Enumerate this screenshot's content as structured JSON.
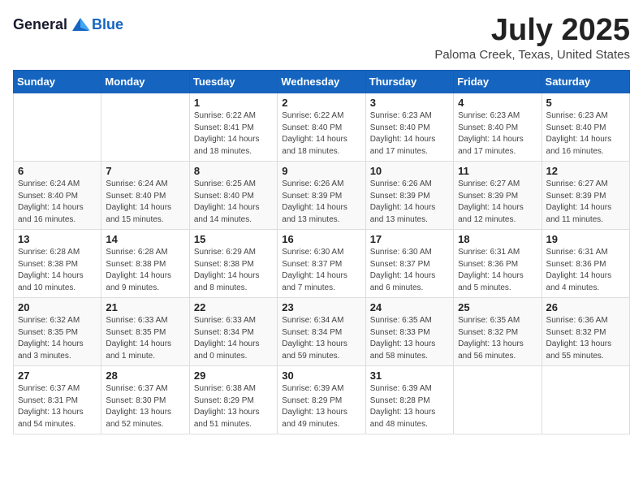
{
  "header": {
    "logo_general": "General",
    "logo_blue": "Blue",
    "month_title": "July 2025",
    "location": "Paloma Creek, Texas, United States"
  },
  "days_of_week": [
    "Sunday",
    "Monday",
    "Tuesday",
    "Wednesday",
    "Thursday",
    "Friday",
    "Saturday"
  ],
  "weeks": [
    [
      {
        "day": "",
        "info": ""
      },
      {
        "day": "",
        "info": ""
      },
      {
        "day": "1",
        "info": "Sunrise: 6:22 AM\nSunset: 8:41 PM\nDaylight: 14 hours and 18 minutes."
      },
      {
        "day": "2",
        "info": "Sunrise: 6:22 AM\nSunset: 8:40 PM\nDaylight: 14 hours and 18 minutes."
      },
      {
        "day": "3",
        "info": "Sunrise: 6:23 AM\nSunset: 8:40 PM\nDaylight: 14 hours and 17 minutes."
      },
      {
        "day": "4",
        "info": "Sunrise: 6:23 AM\nSunset: 8:40 PM\nDaylight: 14 hours and 17 minutes."
      },
      {
        "day": "5",
        "info": "Sunrise: 6:23 AM\nSunset: 8:40 PM\nDaylight: 14 hours and 16 minutes."
      }
    ],
    [
      {
        "day": "6",
        "info": "Sunrise: 6:24 AM\nSunset: 8:40 PM\nDaylight: 14 hours and 16 minutes."
      },
      {
        "day": "7",
        "info": "Sunrise: 6:24 AM\nSunset: 8:40 PM\nDaylight: 14 hours and 15 minutes."
      },
      {
        "day": "8",
        "info": "Sunrise: 6:25 AM\nSunset: 8:40 PM\nDaylight: 14 hours and 14 minutes."
      },
      {
        "day": "9",
        "info": "Sunrise: 6:26 AM\nSunset: 8:39 PM\nDaylight: 14 hours and 13 minutes."
      },
      {
        "day": "10",
        "info": "Sunrise: 6:26 AM\nSunset: 8:39 PM\nDaylight: 14 hours and 13 minutes."
      },
      {
        "day": "11",
        "info": "Sunrise: 6:27 AM\nSunset: 8:39 PM\nDaylight: 14 hours and 12 minutes."
      },
      {
        "day": "12",
        "info": "Sunrise: 6:27 AM\nSunset: 8:39 PM\nDaylight: 14 hours and 11 minutes."
      }
    ],
    [
      {
        "day": "13",
        "info": "Sunrise: 6:28 AM\nSunset: 8:38 PM\nDaylight: 14 hours and 10 minutes."
      },
      {
        "day": "14",
        "info": "Sunrise: 6:28 AM\nSunset: 8:38 PM\nDaylight: 14 hours and 9 minutes."
      },
      {
        "day": "15",
        "info": "Sunrise: 6:29 AM\nSunset: 8:38 PM\nDaylight: 14 hours and 8 minutes."
      },
      {
        "day": "16",
        "info": "Sunrise: 6:30 AM\nSunset: 8:37 PM\nDaylight: 14 hours and 7 minutes."
      },
      {
        "day": "17",
        "info": "Sunrise: 6:30 AM\nSunset: 8:37 PM\nDaylight: 14 hours and 6 minutes."
      },
      {
        "day": "18",
        "info": "Sunrise: 6:31 AM\nSunset: 8:36 PM\nDaylight: 14 hours and 5 minutes."
      },
      {
        "day": "19",
        "info": "Sunrise: 6:31 AM\nSunset: 8:36 PM\nDaylight: 14 hours and 4 minutes."
      }
    ],
    [
      {
        "day": "20",
        "info": "Sunrise: 6:32 AM\nSunset: 8:35 PM\nDaylight: 14 hours and 3 minutes."
      },
      {
        "day": "21",
        "info": "Sunrise: 6:33 AM\nSunset: 8:35 PM\nDaylight: 14 hours and 1 minute."
      },
      {
        "day": "22",
        "info": "Sunrise: 6:33 AM\nSunset: 8:34 PM\nDaylight: 14 hours and 0 minutes."
      },
      {
        "day": "23",
        "info": "Sunrise: 6:34 AM\nSunset: 8:34 PM\nDaylight: 13 hours and 59 minutes."
      },
      {
        "day": "24",
        "info": "Sunrise: 6:35 AM\nSunset: 8:33 PM\nDaylight: 13 hours and 58 minutes."
      },
      {
        "day": "25",
        "info": "Sunrise: 6:35 AM\nSunset: 8:32 PM\nDaylight: 13 hours and 56 minutes."
      },
      {
        "day": "26",
        "info": "Sunrise: 6:36 AM\nSunset: 8:32 PM\nDaylight: 13 hours and 55 minutes."
      }
    ],
    [
      {
        "day": "27",
        "info": "Sunrise: 6:37 AM\nSunset: 8:31 PM\nDaylight: 13 hours and 54 minutes."
      },
      {
        "day": "28",
        "info": "Sunrise: 6:37 AM\nSunset: 8:30 PM\nDaylight: 13 hours and 52 minutes."
      },
      {
        "day": "29",
        "info": "Sunrise: 6:38 AM\nSunset: 8:29 PM\nDaylight: 13 hours and 51 minutes."
      },
      {
        "day": "30",
        "info": "Sunrise: 6:39 AM\nSunset: 8:29 PM\nDaylight: 13 hours and 49 minutes."
      },
      {
        "day": "31",
        "info": "Sunrise: 6:39 AM\nSunset: 8:28 PM\nDaylight: 13 hours and 48 minutes."
      },
      {
        "day": "",
        "info": ""
      },
      {
        "day": "",
        "info": ""
      }
    ]
  ]
}
